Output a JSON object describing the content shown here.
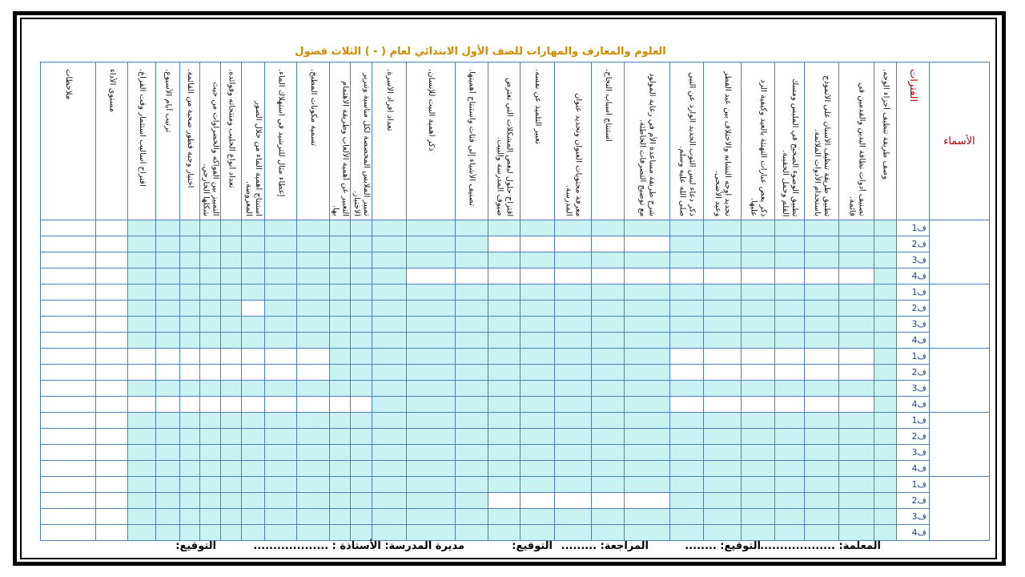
{
  "title": "العلوم والمعارف والمهارات للصف الأول الابتدائي لعام (          -          ) الثلاث فصول",
  "headers": {
    "names": "الأسماء",
    "terms": "الفترات",
    "performance": "مستوى الأداء",
    "notes": "ملاحظات"
  },
  "skills": [
    "وصف طريقة تنظيف أجزاء الوجه.",
    "تصنيف أدوات نظافة اليدين والقدمين في قائمة.",
    "تطبيق طريقة تنظيف الأسنان على الأنموذج باستخدام الأدوات الملائمة.",
    "تطبيق الوضوء الصحيح في الملبس ومسك القلم وحمل الحقيبة.",
    "ذكر بعض عبارات التهنئة بالعيد وكيفية الرد عليها.",
    "تحديد أوجه التشابه والاختلاف بين عيد الفطر وعيد الأضحى.",
    "ذكر دعاء لبس الثوب الجديد الوارد عن النبي صلى الله عليه وسلم.",
    "شرح طريقة مساعدة الأم في رعاية المولود مع توضيح التصرفات الخاطئة.",
    "استنتاج أسباب النجاح.",
    "معرفة محتويات العنوان وتحديد عنوان المدرسة.",
    "تعبير التلميذ عن نفسه.",
    "اقتراح حلول لبعض المشكلات التي تعترض ضيوف المدرسة والبيت.",
    "تصنيف الأشياء إلى فئات واستنتاج أهميتها.",
    "ذكر أهمية البيت للإنسان.",
    "تعداد أفراد الأسرة.",
    "تمييز الملابس المخصصة لكل مناسبة وتبرير الاختيار.",
    "التعبير عن أهمية الألعاب وطريقة الاهتمام بها.",
    "تسمية مكونات المطبخ.",
    "إعطاء مثال للترشيد في استهلاك الماء.",
    "استنتاج أهمية الماء من خلال الصور المعروضة.",
    "تعداد أنواع الحليب ومنتجاته وفوائده.",
    "التمييز بين الفواكه والخضراوات من حيث شكلها الخارجي.",
    "اختيار وجبة فطور صحية من القائمة.",
    "ترتيب أيام الأسبوع.",
    "اقتراح أساليب استثمار وقت الفراغ."
  ],
  "row_terms": [
    "ف1",
    "ف2",
    "ف3",
    "ف4"
  ],
  "student_groups": 5,
  "colors": {
    "cyan_fill": "#c9f2f2",
    "grid_border": "#4d7ebd",
    "title_color": "#d08b00",
    "header_red": "#c00000"
  },
  "footer": {
    "teacher": "المعلمة: ...................",
    "teacher_sign": "التوقيع: ........",
    "reviewer": "المراجعة: .........",
    "reviewer_sign": "التوقيع:",
    "principal": "مديرة المدرسة: الأستاذة : ...................",
    "principal_sign": "التوقيع:"
  }
}
